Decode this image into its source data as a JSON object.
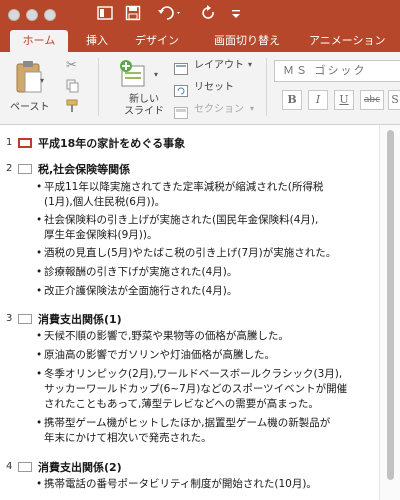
{
  "toolbar": {
    "home_icon": "slides-icon",
    "save_icon": "save-icon",
    "undo_icon": "undo-icon",
    "redo_icon": "redo-icon"
  },
  "tabs": [
    {
      "label": "ホーム",
      "active": true
    },
    {
      "label": "挿入"
    },
    {
      "label": "デザイン"
    },
    {
      "label": "画面切り替え"
    },
    {
      "label": "アニメーション"
    }
  ],
  "ribbon": {
    "paste": "ペースト",
    "new_slide": "新しい\nスライド",
    "new_slide_line1": "新しい",
    "new_slide_line2": "スライド",
    "layout": "レイアウト",
    "reset": "リセット",
    "section": "セクション",
    "font_name": "ＭＳ ゴシック",
    "bold": "B",
    "italic": "I",
    "underline": "U",
    "strike": "abc",
    "shadow": "S"
  },
  "outline": {
    "slides": [
      {
        "num": "1",
        "title": "平成18年の家計をめぐる事象",
        "selected": true,
        "bullets": []
      },
      {
        "num": "2",
        "title": "税,社会保険等関係",
        "bullets": [
          "平成11年以降実施されてきた定率減税が縮減された(所得税",
          "(1月),個人住民税(6月))。",
          "社会保険料の引き上げが実施された(国民年金保険料(4月),",
          "厚生年金保険料(9月))。",
          "酒税の見直し(5月)やたばこ税の引き上げ(7月)が実施された。",
          "診療報酬の引き下げが実施された(4月)。",
          "改正介護保険法が全面施行された(4月)。"
        ]
      },
      {
        "num": "3",
        "title": "消費支出関係(1)",
        "bullets": [
          "天候不順の影響で,野菜や果物等の価格が高騰した。",
          "原油高の影響でガソリンや灯油価格が高騰した。",
          "冬季オリンピック(2月),ワールドベースボールクラシック(3月),",
          "サッカーワールドカップ(6~7月)などのスポーツイベントが開催",
          "されたこともあって,薄型テレビなどへの需要が高まった。",
          "携帯型ゲーム機がヒットしたほか,据置型ゲーム機の新製品が",
          "年末にかけて相次いで発売された。"
        ]
      },
      {
        "num": "4",
        "title": "消費支出関係(2)",
        "bullets": [
          "携帯電話の番号ポータビリティ制度が開始された(10月)。"
        ]
      }
    ]
  }
}
